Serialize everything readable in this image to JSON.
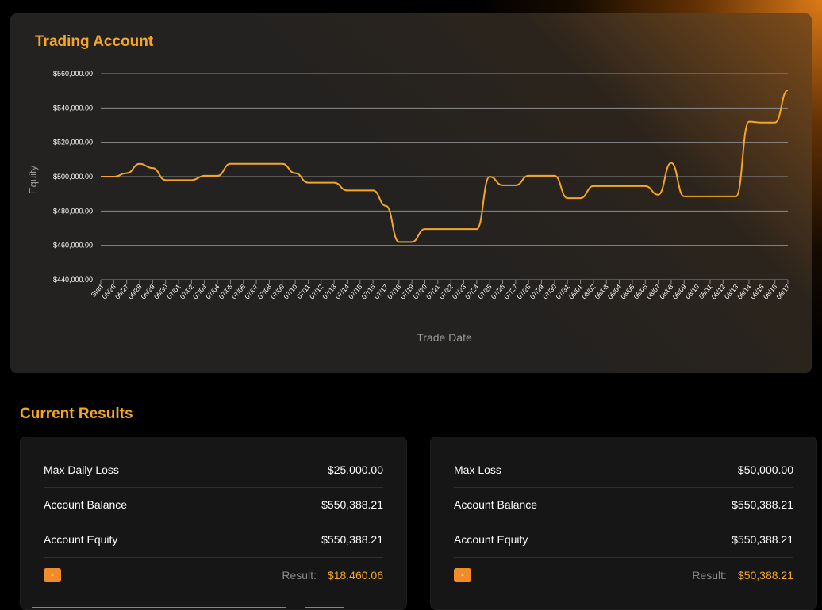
{
  "chart_section": {
    "title": "Trading Account"
  },
  "chart_data": {
    "type": "line",
    "title": "Trading Account",
    "xlabel": "Trade Date",
    "ylabel": "Equity",
    "ylim": [
      440000,
      560000
    ],
    "y_ticks": [
      440000,
      460000,
      480000,
      500000,
      520000,
      540000,
      560000
    ],
    "y_tick_labels": [
      "$440,000.00",
      "$460,000.00",
      "$480,000.00",
      "$500,000.00",
      "$520,000.00",
      "$540,000.00",
      "$560,000.00"
    ],
    "grid": true,
    "line_color": "#f5a623",
    "categories": [
      "Start",
      "06/26",
      "06/27",
      "06/28",
      "06/29",
      "06/30",
      "07/01",
      "07/02",
      "07/03",
      "07/04",
      "07/05",
      "07/06",
      "07/07",
      "07/08",
      "07/09",
      "07/10",
      "07/11",
      "07/12",
      "07/13",
      "07/14",
      "07/15",
      "07/16",
      "07/17",
      "07/18",
      "07/19",
      "07/20",
      "07/21",
      "07/22",
      "07/23",
      "07/24",
      "07/25",
      "07/26",
      "07/27",
      "07/28",
      "07/29",
      "07/30",
      "07/31",
      "08/01",
      "08/02",
      "08/03",
      "08/04",
      "08/05",
      "08/06",
      "08/07",
      "08/08",
      "08/09",
      "08/10",
      "08/11",
      "08/12",
      "08/13",
      "08/14",
      "08/15",
      "08/16",
      "08/17"
    ],
    "values": [
      500000,
      500000,
      502000,
      507500,
      505000,
      498000,
      498000,
      498000,
      500500,
      500500,
      507500,
      507500,
      507500,
      507500,
      507500,
      502000,
      496500,
      496500,
      496500,
      492000,
      492000,
      492000,
      483000,
      462000,
      462000,
      469500,
      469500,
      469500,
      469500,
      469500,
      500000,
      495000,
      495000,
      500500,
      500500,
      500500,
      487500,
      487500,
      494500,
      494500,
      494500,
      494500,
      494500,
      489500,
      508000,
      488500,
      488500,
      488500,
      488500,
      488500,
      532000,
      531500,
      531500,
      550388.21
    ]
  },
  "results_section": {
    "title": "Current Results"
  },
  "panels": [
    {
      "rows": [
        {
          "label": "Max Daily Loss",
          "value": "$25,000.00"
        },
        {
          "label": "Account Balance",
          "value": "$550,388.21"
        },
        {
          "label": "Account Equity",
          "value": "$550,388.21"
        }
      ],
      "badge": "-",
      "result_label": "Result:",
      "result_value": "$18,460.06"
    },
    {
      "rows": [
        {
          "label": "Max Loss",
          "value": "$50,000.00"
        },
        {
          "label": "Account Balance",
          "value": "$550,388.21"
        },
        {
          "label": "Account Equity",
          "value": "$550,388.21"
        }
      ],
      "badge": "-",
      "result_label": "Result:",
      "result_value": "$50,388.21"
    }
  ],
  "colors": {
    "accent": "#f5a623",
    "badge": "#f28c28",
    "card_bg": "#232221",
    "panel_bg": "#161616"
  }
}
